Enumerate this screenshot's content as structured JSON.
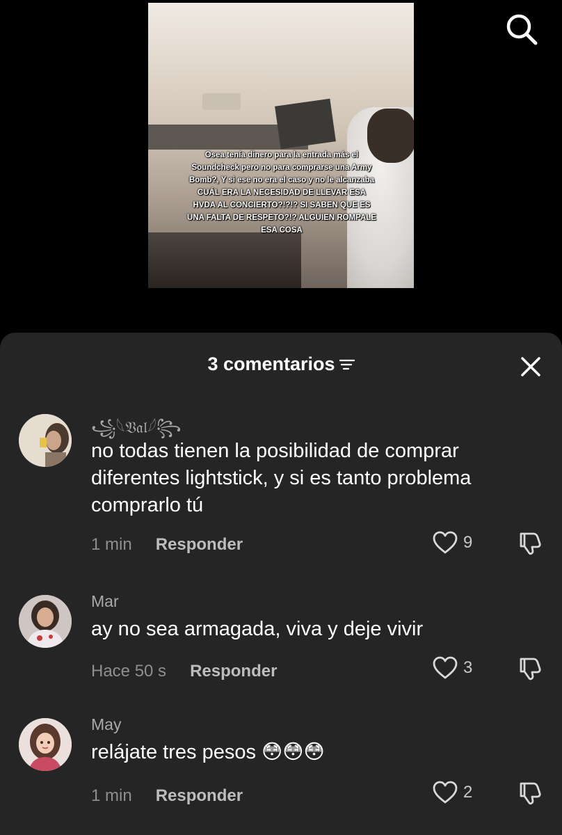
{
  "video": {
    "caption_text": "Osea tenía dinero para la entrada más el Soundcheck pero no para comprarse una Army Bomb?, Y si ese no era el caso y no le alcanzaba CUÁL ERA LA NECESIDAD DE LLEVAR ESA HVDA AL CONCIERTO?!?!? SI SABEN QUE ES UNA FALTA DE RESPETO?!? ALGUIEN ROMPALE ESA COSA"
  },
  "sheet": {
    "title": "3 comentarios"
  },
  "comments": [
    {
      "username": "꧁𓆩𝔙𝔞𝔩𓆪꧂",
      "text": "no todas tienen la posibilidad de comprar diferentes lightstick, y si es tanto problema comprarlo tú",
      "time": "1 min",
      "reply_label": "Responder",
      "likes": "9"
    },
    {
      "username": "Mar",
      "text": "ay no sea armagada, viva y deje vivir",
      "time": "Hace 50 s",
      "reply_label": "Responder",
      "likes": "3"
    },
    {
      "username": "May",
      "text": "relájate tres pesos 😳😳😳",
      "time": "1 min",
      "reply_label": "Responder",
      "likes": "2"
    }
  ]
}
